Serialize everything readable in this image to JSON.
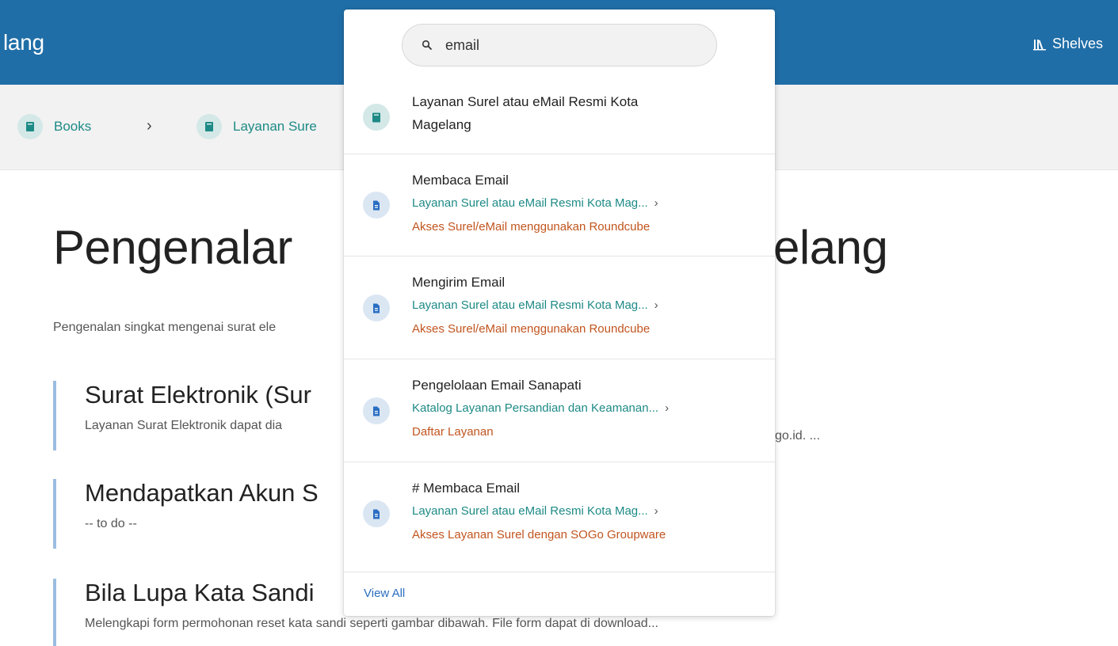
{
  "header": {
    "app_title": "lang",
    "shelves_label": "Shelves"
  },
  "breadcrumb": {
    "items": [
      {
        "label": "Books"
      },
      {
        "label": "Layanan Sure"
      }
    ],
    "separator": "›"
  },
  "page": {
    "title_start": "Pengenalar",
    "title_end": "elang",
    "description": "Pengenalan singkat mengenai surat ele"
  },
  "entries": [
    {
      "title": "Surat Elektronik (Sur",
      "text": "Layanan Surat Elektronik dapat dia",
      "tail": "go.id. ..."
    },
    {
      "title": "Mendapatkan Akun S",
      "text": "-- to do --",
      "tail": ""
    },
    {
      "title": "Bila Lupa Kata Sandi",
      "text": "Melengkapi form permohonan reset kata sandi seperti gambar dibawah. File form dapat di download...",
      "tail": ""
    }
  ],
  "search": {
    "value": "email",
    "results": [
      {
        "type": "book",
        "title_line1": "Layanan Surel atau eMail Resmi Kota",
        "title_line2": "Magelang",
        "book": "",
        "chapter": ""
      },
      {
        "type": "page",
        "title": "Membaca Email",
        "book": "Layanan Surel atau eMail Resmi Kota Mag...",
        "chapter": "Akses Surel/eMail menggunakan Roundcube"
      },
      {
        "type": "page",
        "title": "Mengirim Email",
        "book": "Layanan Surel atau eMail Resmi Kota Mag...",
        "chapter": "Akses Surel/eMail menggunakan Roundcube"
      },
      {
        "type": "page",
        "title": "Pengelolaan Email Sanapati",
        "book": "Katalog Layanan Persandian dan Keamanan...",
        "chapter": "Daftar Layanan"
      },
      {
        "type": "page",
        "title": "# Membaca Email",
        "book": "Layanan Surel atau eMail Resmi Kota Mag...",
        "chapter": "Akses Layanan Surel dengan SOGo Groupware"
      }
    ],
    "view_all": "View All"
  },
  "colors": {
    "header": "#206ea7",
    "book_link": "#1d8a86",
    "chapter_link": "#c1551f",
    "entry_border": "#9bbde0"
  }
}
